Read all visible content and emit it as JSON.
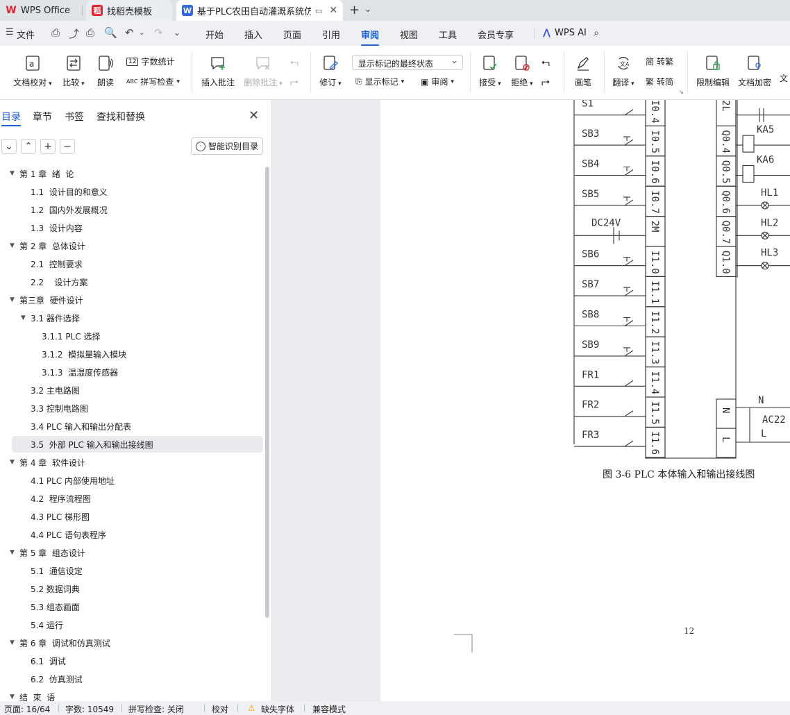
{
  "tabs": [
    {
      "label": "WPS Office",
      "icon": "wps-logo-icon"
    },
    {
      "label": "找稻壳模板",
      "icon": "docer-icon"
    },
    {
      "label": "基于PLC农田自动灌溉系统仿真",
      "icon": "writer-icon"
    }
  ],
  "menu": {
    "file": "文件",
    "items": [
      "开始",
      "插入",
      "页面",
      "引用",
      "审阅",
      "视图",
      "工具",
      "会员专享"
    ],
    "active": "审阅",
    "wps_ai": "WPS AI"
  },
  "ribbon": {
    "proofread": "文档校对",
    "compare": "比较",
    "read_aloud": "朗读",
    "word_count": "字数统计",
    "spell_check": "拼写检查",
    "insert_comment": "插入批注",
    "delete_comment": "删除批注",
    "track": "修订",
    "markup_state": "显示标记的最终状态",
    "show_markup": "显示标记",
    "review": "审阅",
    "accept": "接受",
    "reject": "拒绝",
    "pen": "画笔",
    "translate": "翻译",
    "to_traditional": "转繁",
    "to_simplified": "转简",
    "restrict_edit": "限制编辑",
    "encrypt": "文档加密",
    "more": "文"
  },
  "sidebar": {
    "tabs": [
      "目录",
      "章节",
      "书签",
      "查找和替换"
    ],
    "active_tab": "目录",
    "smart_button": "智能识别目录",
    "toc": [
      {
        "label": "第 1 章  绪  论",
        "level": 1,
        "expanded": true
      },
      {
        "label": "1.1  设计目的和意义",
        "level": 2
      },
      {
        "label": "1.2  国内外发展概况",
        "level": 2
      },
      {
        "label": "1.3  设计内容",
        "level": 2
      },
      {
        "label": "第 2 章  总体设计",
        "level": 1,
        "expanded": true
      },
      {
        "label": "2.1  控制要求",
        "level": 2
      },
      {
        "label": "2.2    设计方案",
        "level": 2
      },
      {
        "label": "第三章  硬件设计",
        "level": 1,
        "expanded": true
      },
      {
        "label": "3.1 器件选择",
        "level": 2,
        "expanded": true
      },
      {
        "label": "3.1.1 PLC 选择",
        "level": 3
      },
      {
        "label": "3.1.2  模拟量输入模块",
        "level": 3
      },
      {
        "label": "3.1.3  温湿度传感器",
        "level": 3
      },
      {
        "label": "3.2 主电路图",
        "level": 2
      },
      {
        "label": "3.3 控制电路图",
        "level": 2
      },
      {
        "label": "3.4 PLC 输入和输出分配表",
        "level": 2
      },
      {
        "label": "3.5  外部 PLC 输入和输出接线图",
        "level": 2,
        "selected": true
      },
      {
        "label": "第 4 章  软件设计",
        "level": 1,
        "expanded": true
      },
      {
        "label": "4.1 PLC 内部使用地址",
        "level": 2
      },
      {
        "label": "4.2  程序流程图",
        "level": 2
      },
      {
        "label": "4.3 PLC 梯形图",
        "level": 2
      },
      {
        "label": "4.4 PLC 语句表程序",
        "level": 2
      },
      {
        "label": "第 5 章  组态设计",
        "level": 1,
        "expanded": true
      },
      {
        "label": "5.1  通信设定",
        "level": 2
      },
      {
        "label": "5.2 数据词典",
        "level": 2
      },
      {
        "label": "5.3 组态画面",
        "level": 2
      },
      {
        "label": "5.4 运行",
        "level": 2
      },
      {
        "label": "第 6 章  调试和仿真测试",
        "level": 1,
        "expanded": true
      },
      {
        "label": "6.1  调试",
        "level": 2
      },
      {
        "label": "6.2  仿真测试",
        "level": 2
      },
      {
        "label": "结  束  语",
        "level": 1,
        "expanded": true
      }
    ]
  },
  "document": {
    "caption": "图 3-6 PLC 本体输入和输出接线图",
    "page_number": "12",
    "diagram": {
      "inputs": [
        {
          "device": "S1",
          "terminal": "I0.4"
        },
        {
          "device": "SB3",
          "terminal": "I0.5"
        },
        {
          "device": "SB4",
          "terminal": "I0.6"
        },
        {
          "device": "SB5",
          "terminal": "I0.7"
        },
        {
          "device": "DC24V",
          "terminal": "2M"
        },
        {
          "device": "SB6",
          "terminal": "I1.0"
        },
        {
          "device": "SB7",
          "terminal": "I1.1"
        },
        {
          "device": "SB8",
          "terminal": "I1.2"
        },
        {
          "device": "SB9",
          "terminal": "I1.3"
        },
        {
          "device": "FR1",
          "terminal": "I1.4"
        },
        {
          "device": "FR2",
          "terminal": "I1.5"
        },
        {
          "device": "FR3",
          "terminal": "I1.6"
        }
      ],
      "outputs": [
        {
          "device": "",
          "terminal": "2L"
        },
        {
          "device": "KA5",
          "terminal": "Q0.4"
        },
        {
          "device": "KA6",
          "terminal": "Q0.5"
        },
        {
          "device": "HL1",
          "terminal": "Q0.6"
        },
        {
          "device": "HL2",
          "terminal": "Q0.7"
        },
        {
          "device": "HL3",
          "terminal": "Q1.0"
        }
      ],
      "power": [
        {
          "device": "N",
          "terminal": "N"
        },
        {
          "device": "AC22",
          "terminal": ""
        },
        {
          "device": "L",
          "terminal": "L"
        }
      ]
    }
  },
  "status": {
    "page": "页面: 16/64",
    "words": "字数: 10549",
    "spell": "拼写检查: 关闭",
    "proof": "校对",
    "missing_font": "缺失字体",
    "compat": "兼容模式"
  }
}
